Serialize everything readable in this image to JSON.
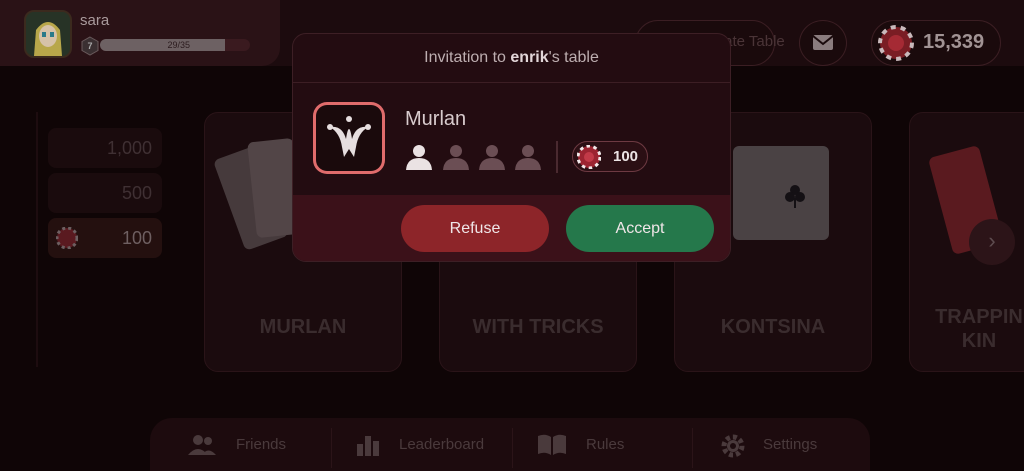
{
  "profile": {
    "username": "sara",
    "level": "7",
    "xp_text": "29/35",
    "xp_progress": 0.83
  },
  "header": {
    "create_table_label": "Create Table",
    "chips": "15,339"
  },
  "stakes": [
    "1,000",
    "500",
    "100"
  ],
  "games": [
    {
      "title": "MURLAN"
    },
    {
      "title": "WITH TRICKS"
    },
    {
      "title": "KONTSINA"
    },
    {
      "title_line1": "TRAPPIN",
      "title_line2": "KIN"
    }
  ],
  "nav": [
    "Friends",
    "Leaderboard",
    "Rules",
    "Settings"
  ],
  "invitation": {
    "prefix": "Invitation to ",
    "host": "enrik",
    "suffix": "'s table",
    "game_name": "Murlan",
    "players_joined": 1,
    "seats": 4,
    "stake": "100",
    "refuse_label": "Refuse",
    "accept_label": "Accept"
  },
  "colors": {
    "accent_red": "#8d2529",
    "accent_green": "#25784b",
    "icon_border": "#e06c6c"
  }
}
